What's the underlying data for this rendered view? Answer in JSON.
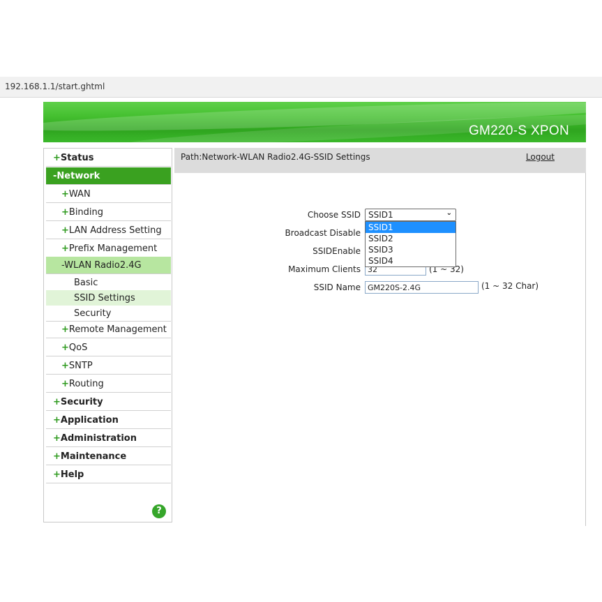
{
  "browser": {
    "url": "192.168.1.1/start.ghtml"
  },
  "banner": {
    "title": "GM220-S XPON"
  },
  "sidebar": {
    "items": [
      {
        "sym": "+",
        "label": "Status"
      },
      {
        "sym": "-",
        "label": "Network"
      },
      {
        "sym": "+",
        "label": "WAN"
      },
      {
        "sym": "+",
        "label": "Binding"
      },
      {
        "sym": "+",
        "label": "LAN Address Setting"
      },
      {
        "sym": "+",
        "label": "Prefix Management"
      },
      {
        "sym": "-",
        "label": "WLAN Radio2.4G"
      },
      {
        "label": "Basic"
      },
      {
        "label": "SSID Settings"
      },
      {
        "label": "Security"
      },
      {
        "sym": "+",
        "label": "Remote Management"
      },
      {
        "sym": "+",
        "label": "QoS"
      },
      {
        "sym": "+",
        "label": "SNTP"
      },
      {
        "sym": "+",
        "label": "Routing"
      },
      {
        "sym": "+",
        "label": "Security"
      },
      {
        "sym": "+",
        "label": "Application"
      },
      {
        "sym": "+",
        "label": "Administration"
      },
      {
        "sym": "+",
        "label": "Maintenance"
      },
      {
        "sym": "+",
        "label": "Help"
      }
    ],
    "help_icon": "?"
  },
  "header": {
    "path": "Path:Network-WLAN Radio2.4G-SSID Settings",
    "logout": "Logout"
  },
  "form": {
    "choose_ssid_label": "Choose SSID",
    "choose_ssid_value": "SSID1",
    "ssid_options": [
      "SSID1",
      "SSID2",
      "SSID3",
      "SSID4"
    ],
    "broadcast_disable_label": "Broadcast Disable",
    "ssid_enable_label": "SSIDEnable",
    "max_clients_label": "Maximum Clients",
    "max_clients_value": "32",
    "max_clients_note": "(1 ~ 32)",
    "ssid_name_label": "SSID Name",
    "ssid_name_value": "GM220S-2.4G",
    "ssid_name_note": "(1 ~ 32 Char)"
  },
  "colors": {
    "brand_green": "#3aa120",
    "submenu_active": "#b7e6a0",
    "dropdown_highlight": "#1e90ff"
  }
}
